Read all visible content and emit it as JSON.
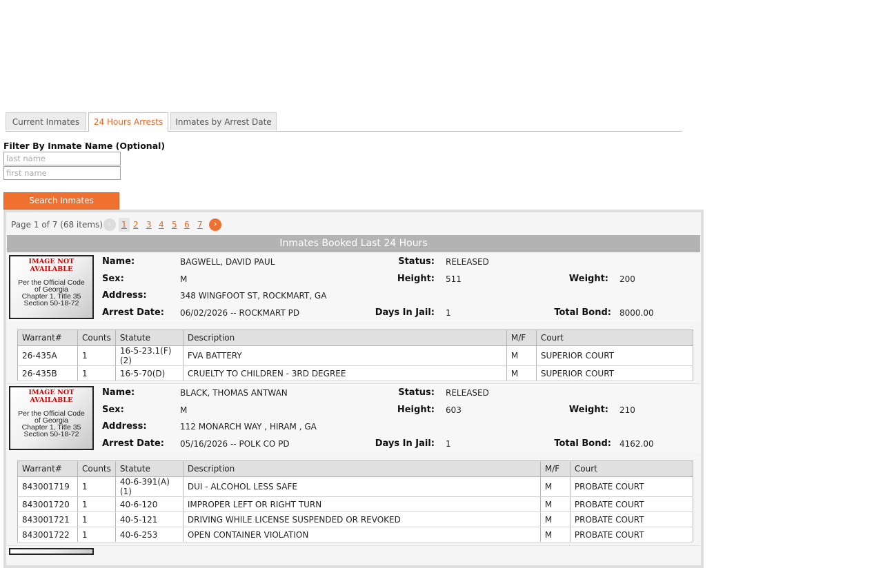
{
  "tabs": [
    {
      "label": "Current Inmates",
      "active": false
    },
    {
      "label": "24 Hours Arrests",
      "active": true
    },
    {
      "label": "Inmates by Arrest Date",
      "active": false
    }
  ],
  "filter": {
    "label": "Filter By Inmate Name (Optional)",
    "last_placeholder": "last name",
    "first_placeholder": "first name",
    "search_label": "Search Inmates"
  },
  "pager": {
    "summary": "Page 1 of 7 (68 items)",
    "pages": [
      "1",
      "2",
      "3",
      "4",
      "5",
      "6",
      "7"
    ],
    "current": "1",
    "prev_icon": "chevron-left-icon",
    "next_icon": "chevron-right-icon",
    "prev_glyph": "‹",
    "next_glyph": "›"
  },
  "section_title": "Inmates Booked Last 24 Hours",
  "labels": {
    "name": "Name:",
    "status": "Status:",
    "sex": "Sex:",
    "height": "Height:",
    "weight": "Weight:",
    "address": "Address:",
    "arrest_date": "Arrest Date:",
    "days_in_jail": "Days In Jail:",
    "total_bond": "Total Bond:"
  },
  "photo": {
    "not_available": "IMAGE NOT AVAILABLE",
    "code_lines": [
      "Per the Official Code",
      "of Georgia",
      "Chapter 1, Title 35",
      "Section 50-18-72"
    ]
  },
  "charge_headers": [
    "Warrant#",
    "Counts",
    "Statute",
    "Description",
    "M/F",
    "Court"
  ],
  "inmates": [
    {
      "name": "BAGWELL, DAVID PAUL",
      "status": "RELEASED",
      "sex": "M",
      "height": "511",
      "weight": "200",
      "address": "348 WINGFOOT ST, ROCKMART, GA",
      "arrest_date": "06/02/2026 -- ROCKMART PD",
      "days_in_jail": "1",
      "total_bond": "8000.00",
      "charges": [
        [
          "26-435A",
          "1",
          "16-5-23.1(F)(2)",
          "FVA BATTERY",
          "M",
          "SUPERIOR COURT"
        ],
        [
          "26-435B",
          "1",
          "16-5-70(D)",
          "CRUELTY TO CHILDREN - 3RD DEGREE",
          "M",
          "SUPERIOR COURT"
        ]
      ]
    },
    {
      "name": "BLACK, THOMAS ANTWAN",
      "status": "RELEASED",
      "sex": "M",
      "height": "603",
      "weight": "210",
      "address": "112 MONARCH WAY , HIRAM , GA",
      "arrest_date": "05/16/2026 -- POLK CO PD",
      "days_in_jail": "1",
      "total_bond": "4162.00",
      "charges": [
        [
          "843001719",
          "1",
          "40-6-391(A)(1)",
          "DUI - ALCOHOL LESS SAFE",
          "M",
          "PROBATE COURT"
        ],
        [
          "843001720",
          "1",
          "40-6-120",
          "IMPROPER LEFT OR RIGHT TURN",
          "M",
          "PROBATE COURT"
        ],
        [
          "843001721",
          "1",
          "40-5-121",
          "DRIVING WHILE LICENSE SUSPENDED OR REVOKED",
          "M",
          "PROBATE COURT"
        ],
        [
          "843001722",
          "1",
          "40-6-253",
          "OPEN CONTAINER VIOLATION",
          "M",
          "PROBATE COURT"
        ]
      ]
    },
    {
      "partial": true
    }
  ]
}
